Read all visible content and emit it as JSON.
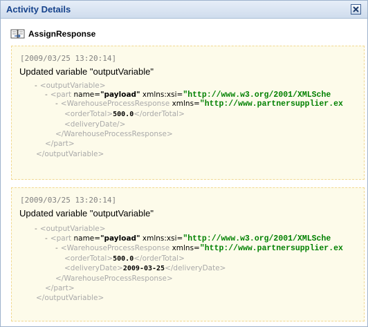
{
  "window": {
    "title": "Activity Details",
    "close_icon": "close-icon"
  },
  "activity": {
    "icon": "assign-activity-icon",
    "name": "AssignResponse"
  },
  "entries": [
    {
      "timestamp": "[2009/03/25 13:20:14]",
      "message": "Updated variable \"outputVariable\"",
      "xml": {
        "output_open": "<outputVariable>",
        "part_tag": "<part",
        "part_name_attr": "name=",
        "part_name_val": "\"payload\"",
        "part_ns_attr": "xmlns:xsi=",
        "part_ns_val": "\"http://www.w3.org/2001/XMLSche",
        "resp_tag": "<WarehouseProcessResponse",
        "resp_ns_attr": "xmlns=",
        "resp_ns_val": "\"http://www.partnersupplier.ex",
        "total_open": "<orderTotal>",
        "total_value": "500.0",
        "total_close": "</orderTotal>",
        "delivery_line": "<deliveryDate/>",
        "resp_close": "</WarehouseProcessResponse>",
        "part_close": "</part>",
        "output_close": "</outputVariable>"
      }
    },
    {
      "timestamp": "[2009/03/25 13:20:14]",
      "message": "Updated variable \"outputVariable\"",
      "xml": {
        "output_open": "<outputVariable>",
        "part_tag": "<part",
        "part_name_attr": "name=",
        "part_name_val": "\"payload\"",
        "part_ns_attr": "xmlns:xsi=",
        "part_ns_val": "\"http://www.w3.org/2001/XMLSche",
        "resp_tag": "<WarehouseProcessResponse",
        "resp_ns_attr": "xmlns=",
        "resp_ns_val": "\"http://www.partnersupplier.ex",
        "total_open": "<orderTotal>",
        "total_value": "500.0",
        "total_close": "</orderTotal>",
        "delivery_open": "<deliveryDate>",
        "delivery_value": "2009-03-25",
        "delivery_close": "</deliveryDate>",
        "resp_close": "</WarehouseProcessResponse>",
        "part_close": "</part>",
        "output_close": "</outputVariable>"
      }
    }
  ],
  "collapse_symbol": "-"
}
